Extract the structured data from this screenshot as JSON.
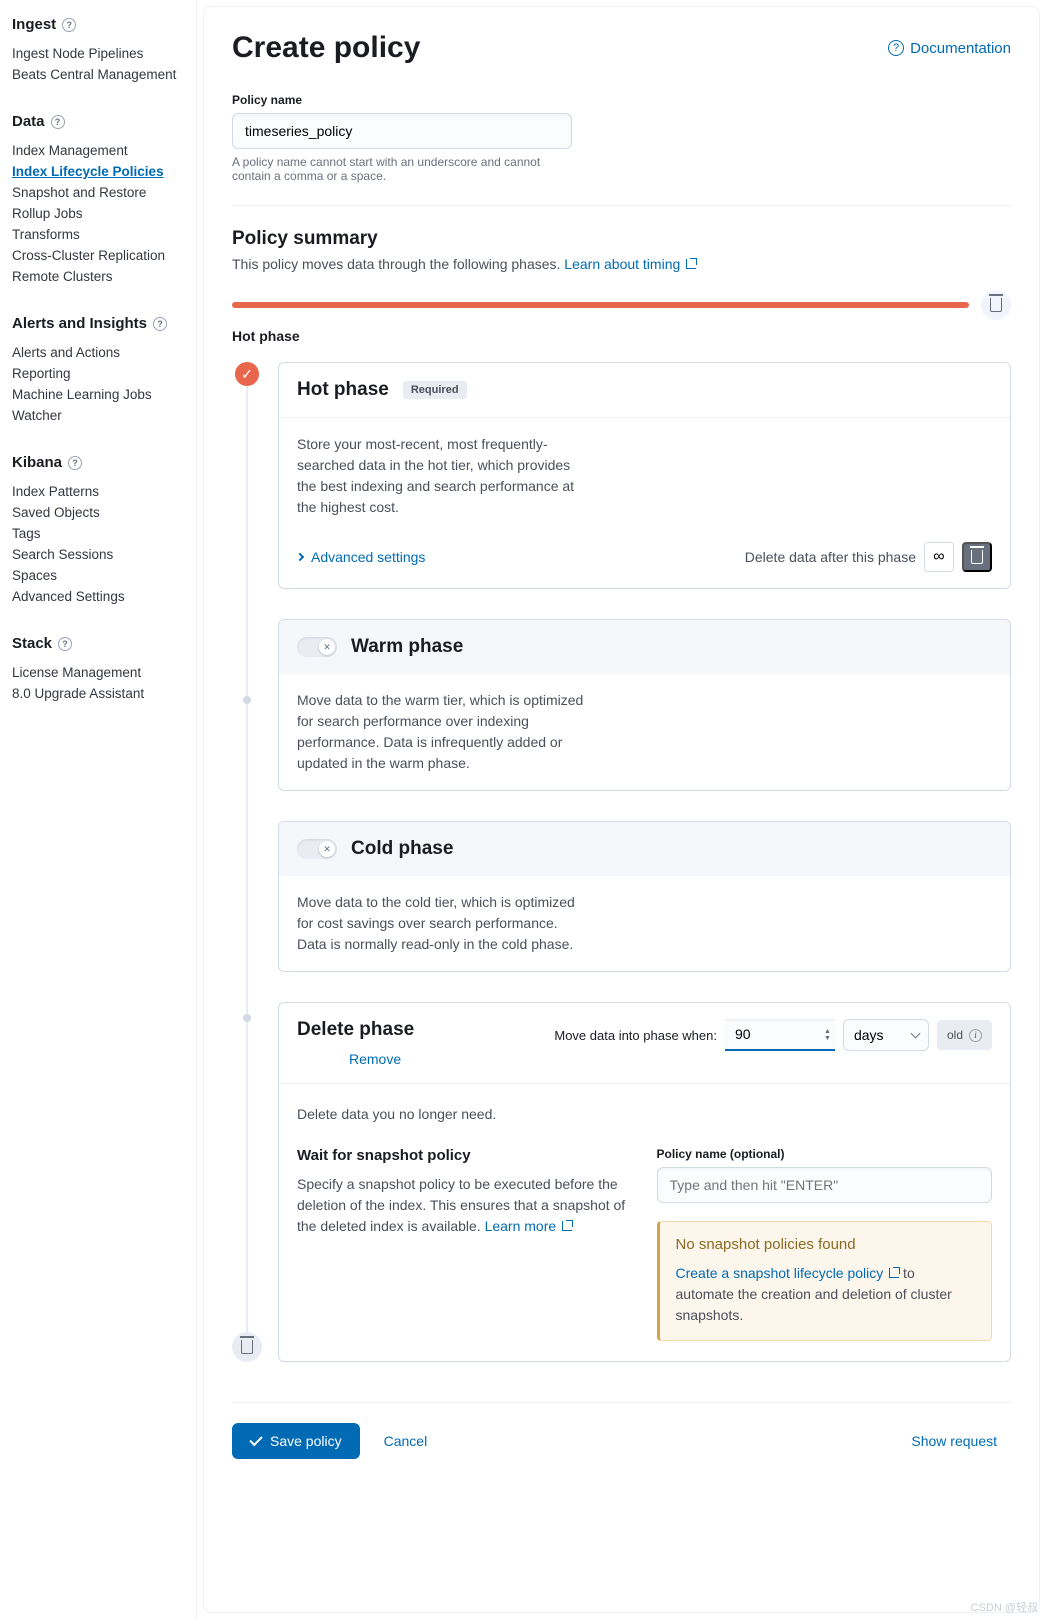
{
  "sidebar": {
    "sections": [
      {
        "title": "Ingest",
        "help": true,
        "items": [
          "Ingest Node Pipelines",
          "Beats Central Management"
        ]
      },
      {
        "title": "Data",
        "help": true,
        "items": [
          "Index Management",
          "Index Lifecycle Policies",
          "Snapshot and Restore",
          "Rollup Jobs",
          "Transforms",
          "Cross-Cluster Replication",
          "Remote Clusters"
        ],
        "active": 1
      },
      {
        "title": "Alerts and Insights",
        "help": true,
        "items": [
          "Alerts and Actions",
          "Reporting",
          "Machine Learning Jobs",
          "Watcher"
        ]
      },
      {
        "title": "Kibana",
        "help": true,
        "items": [
          "Index Patterns",
          "Saved Objects",
          "Tags",
          "Search Sessions",
          "Spaces",
          "Advanced Settings"
        ]
      },
      {
        "title": "Stack",
        "help": true,
        "items": [
          "License Management",
          "8.0 Upgrade Assistant"
        ]
      }
    ]
  },
  "page": {
    "title": "Create policy",
    "documentation": "Documentation",
    "policy_name_label": "Policy name",
    "policy_name_value": "timeseries_policy",
    "policy_name_help": "A policy name cannot start with an underscore and cannot contain a comma or a space."
  },
  "summary": {
    "title": "Policy summary",
    "sub": "This policy moves data through the following phases. ",
    "learn": "Learn about timing",
    "hot_label": "Hot phase"
  },
  "hot": {
    "title": "Hot phase",
    "badge": "Required",
    "desc": "Store your most-recent, most frequently-searched data in the hot tier, which provides the best indexing and search performance at the highest cost.",
    "advanced": "Advanced settings",
    "delete_after": "Delete data after this phase"
  },
  "warm": {
    "title": "Warm phase",
    "desc": "Move data to the warm tier, which is optimized for search performance over indexing performance. Data is infrequently added or updated in the warm phase."
  },
  "cold": {
    "title": "Cold phase",
    "desc": "Move data to the cold tier, which is optimized for cost savings over search performance. Data is normally read-only in the cold phase."
  },
  "del": {
    "title": "Delete phase",
    "remove": "Remove",
    "move_label": "Move data into phase when:",
    "move_value": "90",
    "unit": "days",
    "old": "old",
    "desc": "Delete data you no longer need.",
    "snap_title": "Wait for snapshot policy",
    "snap_desc": "Specify a snapshot policy to be executed before the deletion of the index. This ensures that a snapshot of the deleted index is available. ",
    "learn_more": "Learn more",
    "policy_label": "Policy name (optional)",
    "policy_placeholder": "Type and then hit \"ENTER\"",
    "callout_title": "No snapshot policies found",
    "callout_link": "Create a snapshot lifecycle policy",
    "callout_rest": " to automate the creation and deletion of cluster snapshots."
  },
  "footer": {
    "save": "Save policy",
    "cancel": "Cancel",
    "show_request": "Show request"
  },
  "watermark": "CSDN @轻叔"
}
